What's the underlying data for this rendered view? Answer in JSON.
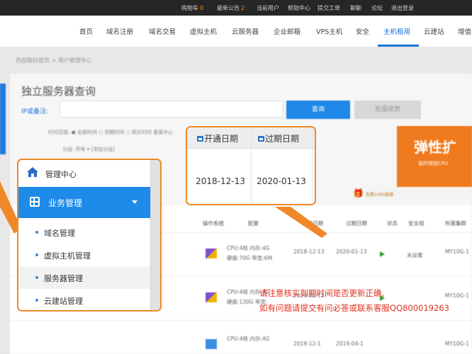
{
  "topbar": {
    "items": [
      {
        "label": "购物车",
        "count": "0"
      },
      {
        "label": "最新公告",
        "count": "2"
      },
      {
        "label": "当前用户"
      },
      {
        "label": "帮助中心"
      },
      {
        "label": "提交工单"
      },
      {
        "label": "聊聊"
      },
      {
        "label": "论坛"
      },
      {
        "label": "退出登录"
      }
    ]
  },
  "nav": {
    "items": [
      "首页",
      "域名注册",
      "域名交易",
      "虚拟主机",
      "云服务器",
      "企业邮箱",
      "VPS主机",
      "安全",
      "主机租用",
      "云建站",
      "增值"
    ],
    "active_index": 8
  },
  "page": {
    "breadcrumb": "西部数码首页 > 用户管理中心",
    "title": "独立服务器查询",
    "ip_label": "IP或备注:",
    "query_button": "查询",
    "batch_button": "批量续费",
    "filter_text": "时间范围: ● 全部时间  ○ 到期时间  ○ 购买时间  备案中心",
    "group_text": "分组:  所有 ▾   [添加分组]",
    "promo_title": "弹性扩",
    "promo_sub": "临时增加CPU",
    "promo_strip": "免费1000套餐"
  },
  "table": {
    "headers": [
      "操作系统",
      "配置",
      "开通日期",
      "过期日期",
      "状态",
      "安全组",
      "所属集群"
    ],
    "rows": [
      {
        "config_1": "CPU:4核 内存:4G",
        "config_2": "硬盘:70G 带宽:6M",
        "open_date": "2018-12-13",
        "expire_date": "2020-01-13",
        "security": "未设置",
        "cluster": "MY10G-1"
      },
      {
        "config_1": "CPU:4核 内存:4G",
        "config_2": "硬盘:130G 带宽:",
        "open_date": "2018-12-13",
        "expire_date": "",
        "security": "",
        "cluster": "MY10G-1"
      },
      {
        "config_1": "CPU:4核 内存:4G",
        "config_2": "",
        "open_date": "2018-12-1",
        "expire_date": "2019-04-1",
        "security": "",
        "cluster": "MY10G-1"
      }
    ]
  },
  "callout": {
    "open_header": "开通日期",
    "expire_header": "过期日期",
    "open_value": "2018-12-13",
    "expire_value": "2020-01-13"
  },
  "menu": {
    "header": "管理中心",
    "section": "业务管理",
    "items": [
      "域名管理",
      "虚拟主机管理",
      "服务器管理",
      "云建站管理"
    ],
    "active_index": 2
  },
  "note": {
    "line1": "请注意核实到期时间是否更新正确,",
    "line2": "如有问题请提交有问必答或联系客服QQ800019263"
  },
  "colors": {
    "accent": "#1f8be8",
    "highlight": "#f0882a",
    "note": "#e0301e"
  }
}
